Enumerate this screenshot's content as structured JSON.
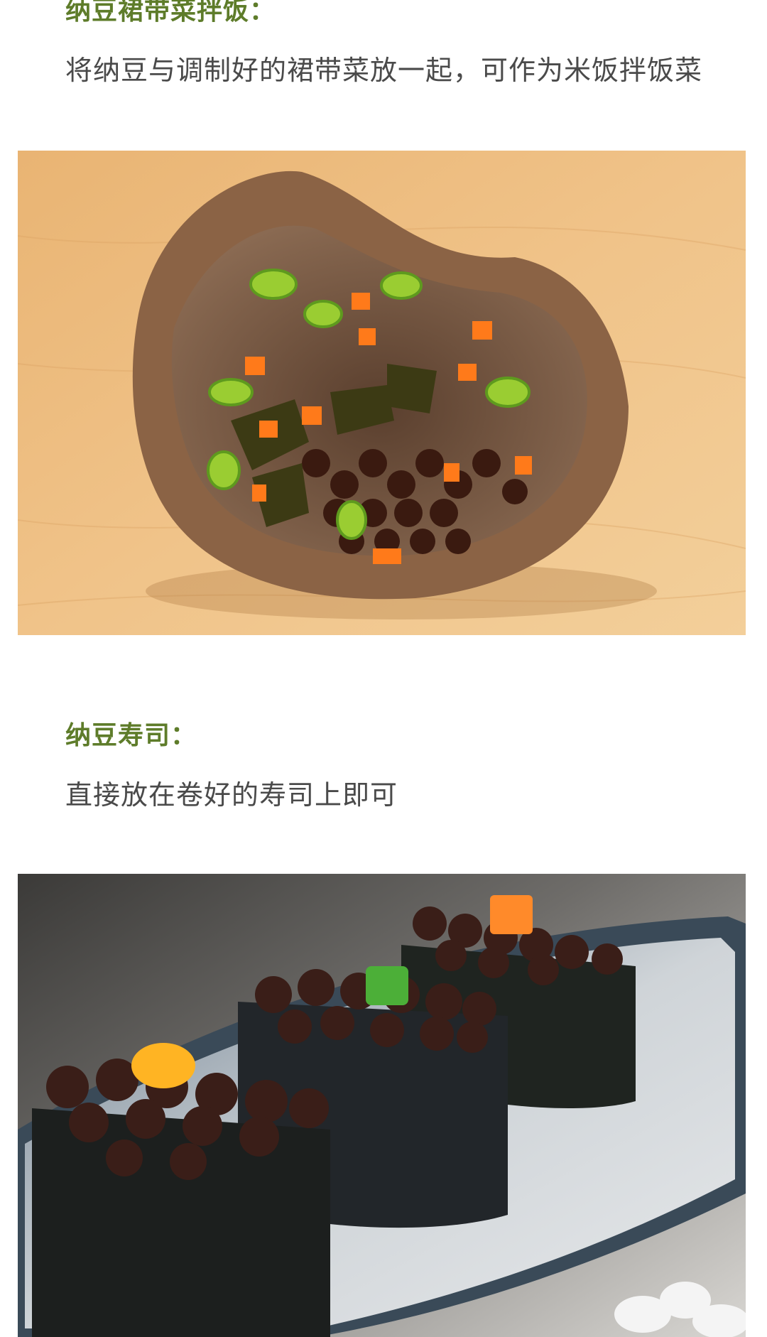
{
  "sections": [
    {
      "title": "纳豆裙带菜拌饭：",
      "text": "将纳豆与调制好的裙带菜放一起，可作为米饭拌饭菜",
      "image_subject": "natto-wakame-bowl-photo"
    },
    {
      "title": "纳豆寿司：",
      "text": "直接放在卷好的寿司上即可",
      "image_subject": "natto-sushi-photo"
    }
  ],
  "colors": {
    "title": "#5e7c2a",
    "body_text": "#4a4a4a",
    "background": "#ffffff"
  }
}
